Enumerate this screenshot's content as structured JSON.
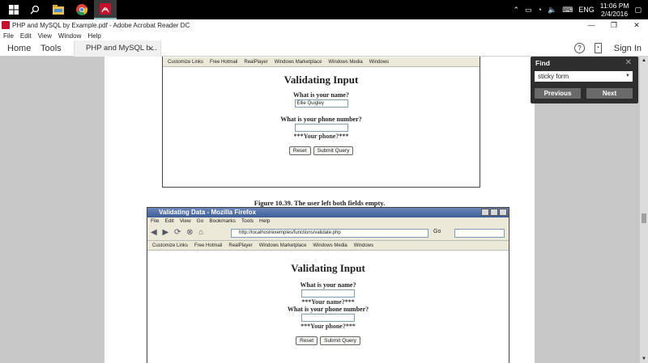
{
  "taskbar": {
    "clock_time": "11:06 PM",
    "clock_date": "2/4/2016",
    "language": "ENG"
  },
  "window": {
    "title": "PHP and MySQL by Example.pdf - Adobe Acrobat Reader DC"
  },
  "menu": [
    "File",
    "Edit",
    "View",
    "Window",
    "Help"
  ],
  "acrobat_toolbar": {
    "home": "Home",
    "tools": "Tools",
    "doc_tab": "PHP and MySQL b...",
    "sign_in": "Sign In"
  },
  "find_panel": {
    "title": "Find",
    "query": "sticky form",
    "previous": "Previous",
    "next": "Next"
  },
  "figure_top": {
    "links": [
      "Customize Links",
      "Free Hotmail",
      "RealPlayer",
      "Windows Marketplace",
      "Windows Media",
      "Windows"
    ],
    "heading": "Validating Input",
    "name_label": "What is your name?",
    "name_value": "Ellie Quigley",
    "phone_label": "What is your phone number?",
    "phone_error": "***Your phone?***",
    "reset": "Reset",
    "submit": "Submit Query"
  },
  "caption": "Figure 10.39. The user left both fields empty.",
  "figure_bottom": {
    "window_title": "Validating Data - Mozilla Firefox",
    "menu": [
      "File",
      "Edit",
      "View",
      "Go",
      "Bookmarks",
      "Tools",
      "Help"
    ],
    "url": "http://localhost/exemples/functions/validate.php",
    "go": "Go",
    "links": [
      "Customize Links",
      "Free Hotmail",
      "RealPlayer",
      "Windows Marketplace",
      "Windows Media",
      "Windows"
    ],
    "heading": "Validating Input",
    "name_label": "What is your name?",
    "name_error": "***Your name?***",
    "phone_label": "What is your phone number?",
    "phone_error": "***Your phone?***",
    "reset": "Reset",
    "submit": "Submit Query"
  }
}
